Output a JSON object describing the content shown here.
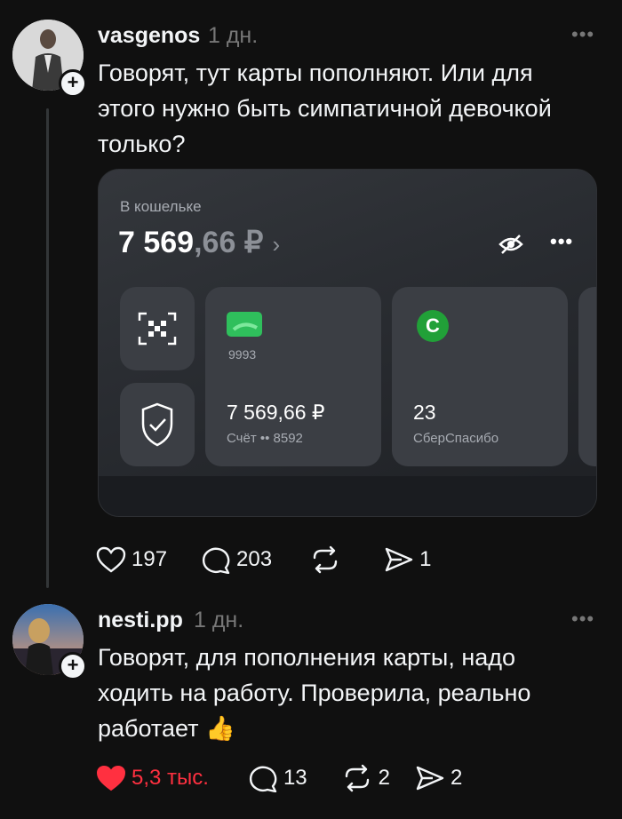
{
  "posts": [
    {
      "username": "vasgenos",
      "time": "1 дн.",
      "text_lines": [
        "Говорят, тут карты пополняют. Или для",
        "этого нужно быть симпатичной девочкой",
        "только?"
      ],
      "likes": "197",
      "comments": "203",
      "shares": "1",
      "liked": false,
      "avatar_icon": "person-photo-icon",
      "card": {
        "wallet_label": "В кошельке",
        "balance_main": "7 569",
        "balance_kop": ",66 ₽",
        "balance_arrow": "›",
        "card_last": "9993",
        "account_amount": "7 569,66 ₽",
        "account_label": "Счёт •• 8592",
        "spasibo_amount": "23",
        "spasibo_label": "СберСпасибо",
        "spasibo_letter": "С",
        "more": "•••"
      }
    },
    {
      "username": "nesti.pp",
      "time": "1 дн.",
      "text_lines": [
        "Говорят, для пополнения карты, надо",
        "ходить на работу. Проверила, реально",
        "работает 👍"
      ],
      "likes": "5,3 тыс.",
      "comments": "13",
      "reposts": "2",
      "shares": "2",
      "liked": true,
      "avatar_icon": "person-photo-icon"
    }
  ],
  "more_label": "•••",
  "colors": {
    "background": "#101010",
    "text": "#f3f5f7",
    "muted": "#777777",
    "like": "#ff3040",
    "sber_green": "#21a038"
  }
}
